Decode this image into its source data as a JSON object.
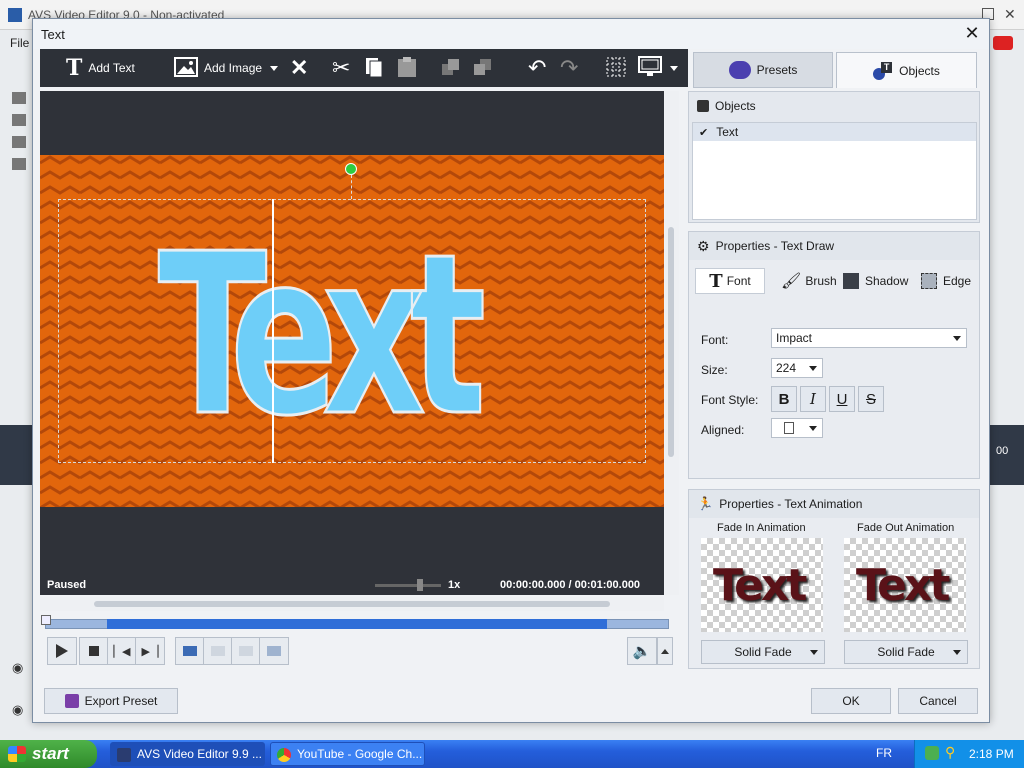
{
  "background_app": {
    "title": "AVS Video Editor 9.0 - Non-activated",
    "menu_file": "File",
    "right_strip_text": "00"
  },
  "dialog": {
    "title": "Text",
    "close_glyph": "✕"
  },
  "toolbar": {
    "add_text_label": "Add Text",
    "add_image_label": "Add Image"
  },
  "tabs": {
    "presets": "Presets",
    "objects": "Objects"
  },
  "preview": {
    "text": "Text",
    "status": "Paused",
    "speed": "1x",
    "time": "00:00:00.000  /  00:01:00.000"
  },
  "objects_panel": {
    "header": "Objects",
    "items": [
      {
        "label": "Text",
        "checked": true
      }
    ]
  },
  "properties": {
    "header": "Properties - Text Draw",
    "subtabs": {
      "font": "Font",
      "brush": "Brush",
      "shadow": "Shadow",
      "edge": "Edge"
    },
    "font_label": "Font:",
    "font_value": "Impact",
    "size_label": "Size:",
    "size_value": "224",
    "style_label": "Font Style:",
    "aligned_label": "Aligned:",
    "style_buttons": {
      "bold": "B",
      "italic": "I",
      "underline": "U",
      "strike": "S"
    }
  },
  "animation": {
    "header": "Properties - Text Animation",
    "fade_in_label": "Fade In Animation",
    "fade_out_label": "Fade Out Animation",
    "thumb_text": "Text",
    "fade_in_value": "Solid Fade",
    "fade_out_value": "Solid Fade"
  },
  "footer": {
    "export_preset": "Export Preset",
    "ok": "OK",
    "cancel": "Cancel"
  },
  "taskbar": {
    "start": "start",
    "items": [
      "AVS Video Editor 9.9 ...",
      "YouTube - Google Ch..."
    ],
    "language": "FR",
    "clock": "2:18 PM"
  },
  "colors": {
    "canvas_bg": "#e2660c",
    "text_fill": "#6ecef8",
    "timeline_fill": "#2f6ed8"
  }
}
